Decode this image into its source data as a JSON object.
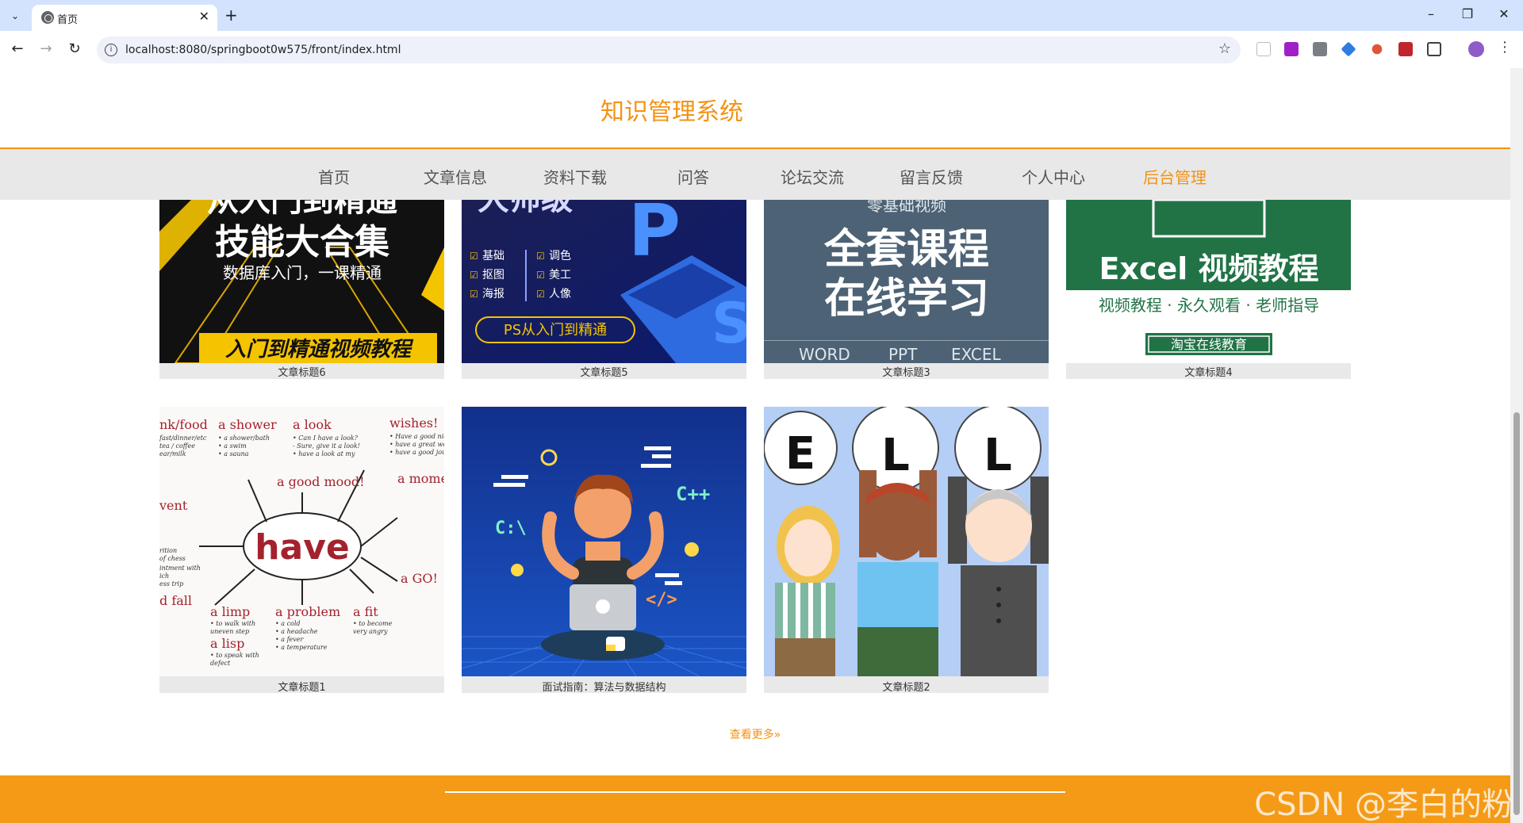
{
  "browser": {
    "tab_title": "首页",
    "url": "localhost:8080/springboot0w575/front/index.html"
  },
  "site": {
    "title": "知识管理系统",
    "nav": [
      "首页",
      "文章信息",
      "资料下载",
      "问答",
      "论坛交流",
      "留言反馈",
      "个人中心",
      "后台管理"
    ],
    "active_nav": "后台管理",
    "accent_color": "#f39315"
  },
  "articles_row1": [
    {
      "caption": "文章标题6",
      "image_text": [
        "技能大合集",
        "数据库入门，一课精通",
        "入门到精通视频教程"
      ]
    },
    {
      "caption": "文章标题5",
      "image_text": [
        "基础",
        "调色",
        "抠图",
        "美工",
        "海报",
        "人像",
        "PS从入门到精通"
      ]
    },
    {
      "caption": "文章标题3",
      "image_text": [
        "零基础视频",
        "全套课程",
        "在线学习",
        "WORD",
        "PPT",
        "EXCEL"
      ]
    },
    {
      "caption": "文章标题4",
      "image_text": [
        "Excel 视频教程",
        "视频教程 · 永久观看 · 老师指导",
        "淘宝在线教育"
      ]
    }
  ],
  "articles_row2": [
    {
      "caption": "文章标题1",
      "image_text": [
        "have",
        "a good mood!",
        "a shower",
        "a look",
        "wishes!",
        "a limp",
        "a problem",
        "a fit",
        "a lisp",
        "a GO!"
      ]
    },
    {
      "caption": "面试指南：算法与数据结构",
      "image_text": [
        "C++",
        "C:\\",
        "</>"
      ]
    },
    {
      "caption": "文章标题2",
      "image_text": [
        "E",
        "L",
        "L"
      ]
    }
  ],
  "more_link": "查看更多",
  "watermark": "CSDN @李白的粉"
}
